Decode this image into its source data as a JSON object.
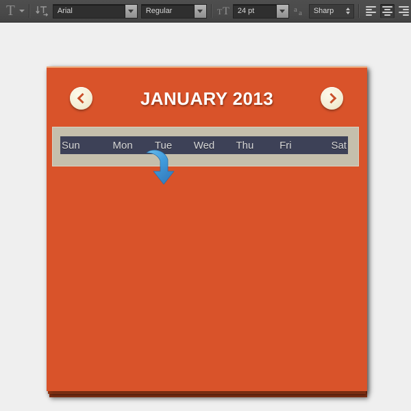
{
  "toolbar": {
    "text_tool": {
      "icon": "text-tool-icon",
      "glyph": "T"
    },
    "orientation_tool": {
      "icon": "text-orientation-icon"
    },
    "font_family": {
      "label": "Font family",
      "value": "Arial",
      "icon": "chevron-down-icon"
    },
    "font_style": {
      "label": "Font style",
      "value": "Regular",
      "icon": "chevron-down-icon"
    },
    "font_size_icon": {
      "icon": "font-size-icon",
      "glyph": "T"
    },
    "font_size": {
      "label": "Font size",
      "value": "24 pt",
      "icon": "chevron-down-icon"
    },
    "antialias_icon": {
      "icon": "anti-aliasing-icon",
      "glyph": "a"
    },
    "antialias": {
      "label": "Anti-aliasing method",
      "value": "Sharp",
      "icon": "stepper-arrows-icon"
    },
    "align": {
      "left": {
        "label": "Align left",
        "icon": "align-left-icon",
        "active": false
      },
      "center": {
        "label": "Align center",
        "icon": "align-center-icon",
        "active": true
      },
      "right": {
        "label": "Align right",
        "icon": "align-right-icon",
        "active": false
      }
    }
  },
  "calendar": {
    "title": "JANUARY 2013",
    "month": "JANUARY",
    "year": "2013",
    "prev_button": {
      "label": "Previous month",
      "icon": "chevron-left-icon"
    },
    "next_button": {
      "label": "Next month",
      "icon": "chevron-right-icon"
    },
    "weekdays": [
      "Sun",
      "Mon",
      "Tue",
      "Wed",
      "Thu",
      "Fri",
      "Sat"
    ],
    "selected_text": "Sun    Mon    Tue    Wed    Thu    Fri    Sat",
    "annotation": {
      "name": "curved-arrow-annotation",
      "points_at": "Mon",
      "color": "#3d9ce0"
    }
  },
  "colors": {
    "panel_orange": "#d9532a",
    "panel_top_highlight": "#f0a878",
    "sheet_shadow_1": "#a23d18",
    "sheet_shadow_2": "#8f3517",
    "weekday_band": "#c5bfac",
    "selection_navy": "#3d4157",
    "selection_text": "#d6d6d6",
    "nav_button_cream": "#f4eed6",
    "nav_chevron": "#c9502a",
    "title_white": "#ffffff",
    "toolbar_gray": "#4a4a4a",
    "canvas_gray": "#efefef",
    "arrow_blue": "#3d9ce0"
  }
}
